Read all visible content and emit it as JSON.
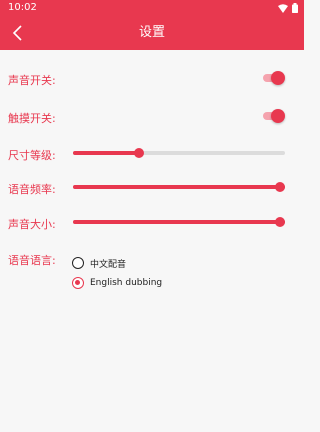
{
  "status_bar": {
    "time": "10:02",
    "icons": [
      "wifi-icon",
      "battery-icon"
    ]
  },
  "app_bar": {
    "title": "设置",
    "back_icon": "chevron-left-icon"
  },
  "settings": {
    "sound_switch": {
      "label": "声音开关:",
      "on": true
    },
    "touch_switch": {
      "label": "触摸开关:",
      "on": true
    },
    "size_level": {
      "label": "尺寸等级:",
      "value_fraction": 0.31
    },
    "voice_rate": {
      "label": "语音频率:",
      "value_fraction": 1.0
    },
    "sound_volume": {
      "label": "声音大小:",
      "value_fraction": 1.0
    },
    "voice_language": {
      "label": "语音语言:",
      "options": [
        {
          "label": "中文配音",
          "selected": false
        },
        {
          "label": "English dubbing",
          "selected": true
        }
      ]
    }
  },
  "colors": {
    "accent": "#e8384f",
    "accent_light": "#f5a3ae",
    "background": "#f7f7f7",
    "track": "#dcdcdc"
  }
}
